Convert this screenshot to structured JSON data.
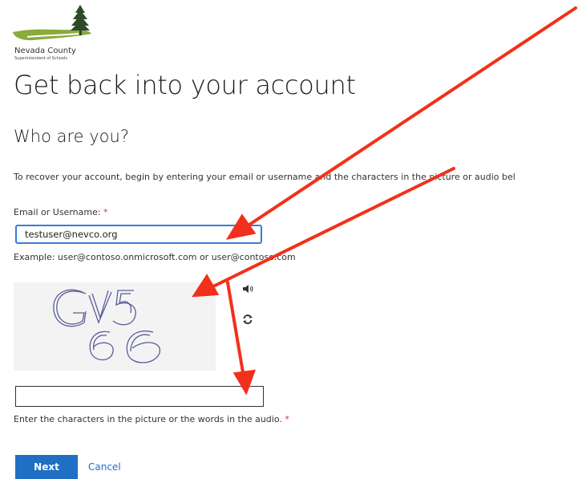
{
  "logo": {
    "name": "Nevada County",
    "subtitle": "Superintendent of Schools"
  },
  "page": {
    "title": "Get back into your account",
    "subtitle": "Who are you?",
    "instructions": "To recover your account, begin by entering your email or username and the characters in the picture or audio bel"
  },
  "form": {
    "email_label": "Email or Username:",
    "required_mark": "*",
    "email_value": "testuser@nevco.org",
    "example": "Example: user@contoso.onmicrosoft.com or user@contoso.com",
    "captcha_text": "GV5 66",
    "audio_icon": "speaker-icon",
    "refresh_icon": "refresh-icon",
    "captcha_label": "Enter the characters in the picture or the words in the audio.",
    "captcha_value": ""
  },
  "actions": {
    "next_label": "Next",
    "cancel_label": "Cancel"
  },
  "colors": {
    "accent": "#1f6fc5",
    "input_focus": "#3a7bd5",
    "required": "#d13438",
    "annotation_arrow": "#f2301b",
    "logo_green": "#8aaa3c"
  }
}
